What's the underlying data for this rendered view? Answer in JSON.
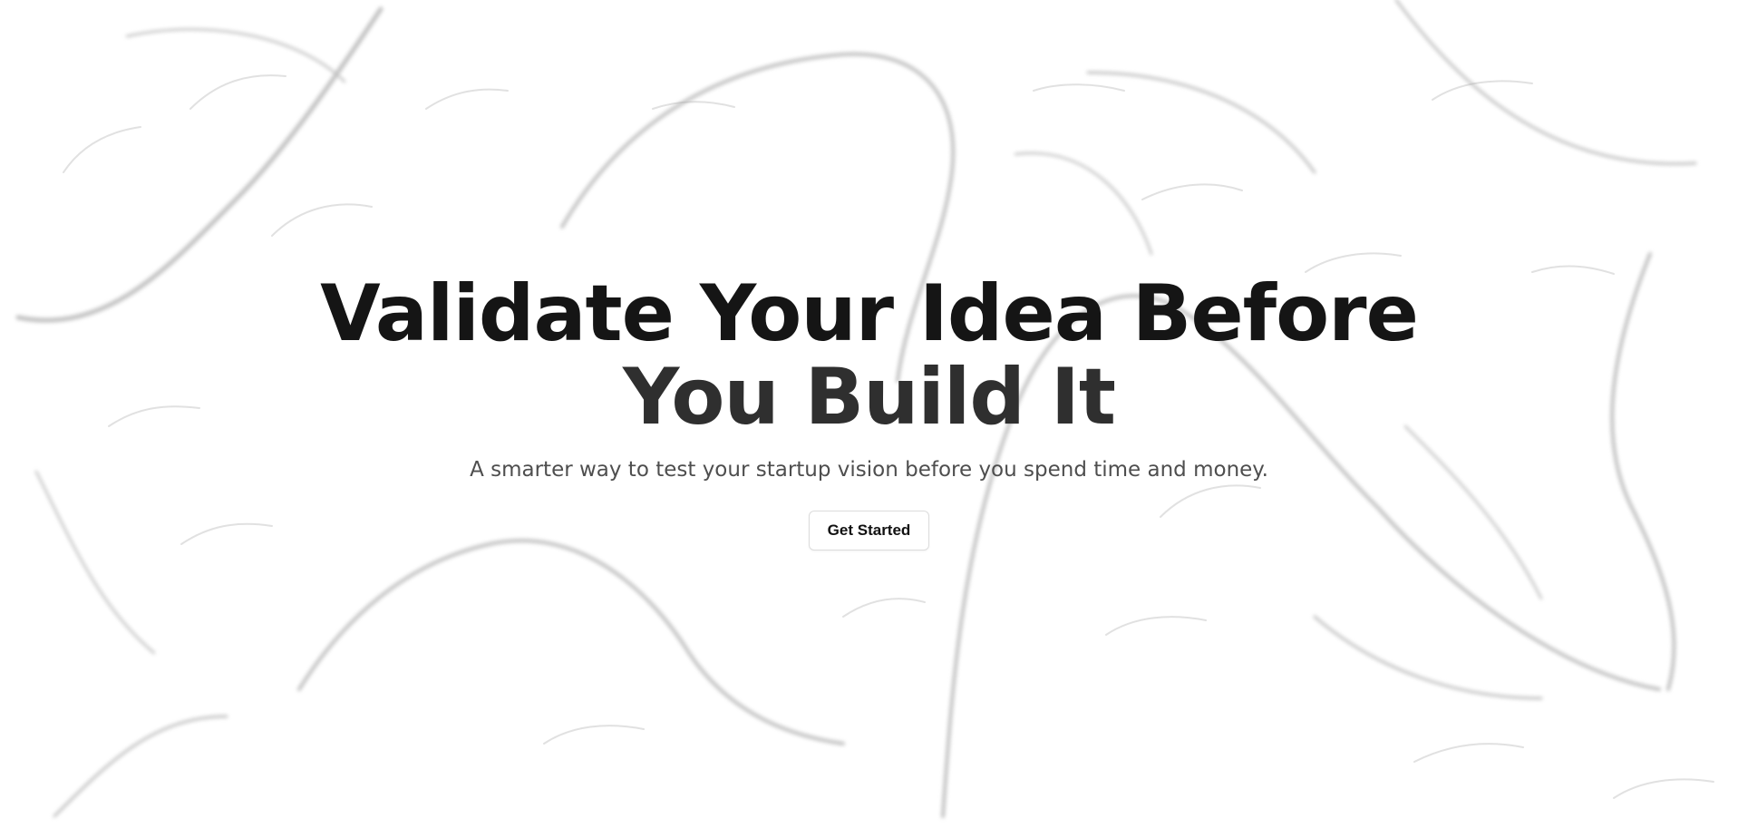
{
  "hero": {
    "title_line_1": "Validate Your Idea Before",
    "title_line_2": "You Build It",
    "subtitle": "A smarter way to test your startup vision before you spend time and money.",
    "cta_label": "Get Started"
  },
  "colors": {
    "background": "#ffffff",
    "title": "#151515",
    "subtitle": "#4e4e4e",
    "stroke": "#8a8a8a"
  },
  "icons": {
    "background": "flow-field-pattern"
  }
}
